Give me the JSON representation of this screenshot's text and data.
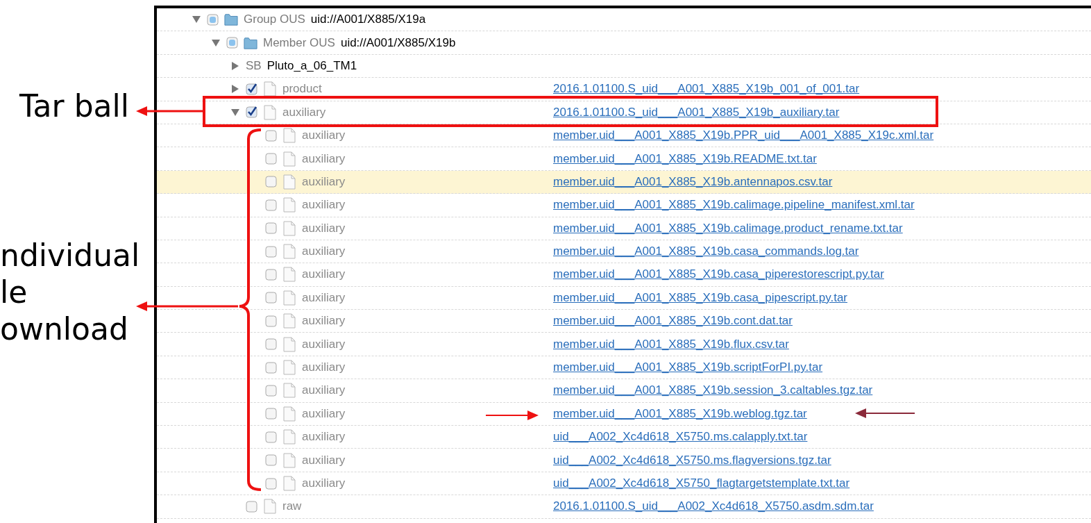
{
  "annotations": {
    "tarball_label": "Tar ball",
    "individual_label": [
      "ndividual",
      "le",
      "ownload"
    ]
  },
  "tree": [
    {
      "kind": "folder",
      "type_label": "Group OUS",
      "name": "uid://A001/X885/X19a",
      "expanded": true,
      "checked": false,
      "partial": true,
      "highlighted": false,
      "children": [
        {
          "kind": "folder",
          "type_label": "Member OUS",
          "name": "uid://A001/X885/X19b",
          "expanded": true,
          "checked": false,
          "partial": true,
          "highlighted": false,
          "children": [
            {
              "kind": "schedblock",
              "type_label": "SB",
              "name": "Pluto_a_06_TM1",
              "expanded": false,
              "highlighted": false
            },
            {
              "kind": "file",
              "name": "product",
              "expanded": false,
              "checked": true,
              "partial": false,
              "highlighted": false,
              "link": "2016.1.01100.S_uid___A001_X885_X19b_001_of_001.tar"
            },
            {
              "kind": "file",
              "name": "auxiliary",
              "expanded": true,
              "checked": true,
              "partial": false,
              "highlighted": false,
              "link": "2016.1.01100.S_uid___A001_X885_X19b_auxiliary.tar",
              "children": [
                {
                  "kind": "file",
                  "name": "auxiliary",
                  "checked": false,
                  "partial": false,
                  "highlighted": false,
                  "link": "member.uid___A001_X885_X19b.PPR_uid___A001_X885_X19c.xml.tar"
                },
                {
                  "kind": "file",
                  "name": "auxiliary",
                  "checked": false,
                  "partial": false,
                  "highlighted": false,
                  "link": "member.uid___A001_X885_X19b.README.txt.tar"
                },
                {
                  "kind": "file",
                  "name": "auxiliary",
                  "checked": false,
                  "partial": false,
                  "highlighted": true,
                  "link": "member.uid___A001_X885_X19b.antennapos.csv.tar"
                },
                {
                  "kind": "file",
                  "name": "auxiliary",
                  "checked": false,
                  "partial": false,
                  "highlighted": false,
                  "link": "member.uid___A001_X885_X19b.calimage.pipeline_manifest.xml.tar"
                },
                {
                  "kind": "file",
                  "name": "auxiliary",
                  "checked": false,
                  "partial": false,
                  "highlighted": false,
                  "link": "member.uid___A001_X885_X19b.calimage.product_rename.txt.tar"
                },
                {
                  "kind": "file",
                  "name": "auxiliary",
                  "checked": false,
                  "partial": false,
                  "highlighted": false,
                  "link": "member.uid___A001_X885_X19b.casa_commands.log.tar"
                },
                {
                  "kind": "file",
                  "name": "auxiliary",
                  "checked": false,
                  "partial": false,
                  "highlighted": false,
                  "link": "member.uid___A001_X885_X19b.casa_piperestorescript.py.tar"
                },
                {
                  "kind": "file",
                  "name": "auxiliary",
                  "checked": false,
                  "partial": false,
                  "highlighted": false,
                  "link": "member.uid___A001_X885_X19b.casa_pipescript.py.tar"
                },
                {
                  "kind": "file",
                  "name": "auxiliary",
                  "checked": false,
                  "partial": false,
                  "highlighted": false,
                  "link": "member.uid___A001_X885_X19b.cont.dat.tar"
                },
                {
                  "kind": "file",
                  "name": "auxiliary",
                  "checked": false,
                  "partial": false,
                  "highlighted": false,
                  "link": "member.uid___A001_X885_X19b.flux.csv.tar"
                },
                {
                  "kind": "file",
                  "name": "auxiliary",
                  "checked": false,
                  "partial": false,
                  "highlighted": false,
                  "link": "member.uid___A001_X885_X19b.scriptForPI.py.tar"
                },
                {
                  "kind": "file",
                  "name": "auxiliary",
                  "checked": false,
                  "partial": false,
                  "highlighted": false,
                  "link": "member.uid___A001_X885_X19b.session_3.caltables.tgz.tar"
                },
                {
                  "kind": "file",
                  "name": "auxiliary",
                  "checked": false,
                  "partial": false,
                  "highlighted": false,
                  "link": "member.uid___A001_X885_X19b.weblog.tgz.tar"
                },
                {
                  "kind": "file",
                  "name": "auxiliary",
                  "checked": false,
                  "partial": false,
                  "highlighted": false,
                  "link": "uid___A002_Xc4d618_X5750.ms.calapply.txt.tar"
                },
                {
                  "kind": "file",
                  "name": "auxiliary",
                  "checked": false,
                  "partial": false,
                  "highlighted": false,
                  "link": "uid___A002_Xc4d618_X5750.ms.flagversions.tgz.tar"
                },
                {
                  "kind": "file",
                  "name": "auxiliary",
                  "checked": false,
                  "partial": false,
                  "highlighted": false,
                  "link": "uid___A002_Xc4d618_X5750_flagtargetstemplate.txt.tar"
                }
              ]
            },
            {
              "kind": "file",
              "name": "raw",
              "checked": false,
              "partial": false,
              "highlighted": false,
              "link": "2016.1.01100.S_uid___A002_Xc4d618_X5750.asdm.sdm.tar"
            }
          ]
        }
      ]
    }
  ]
}
